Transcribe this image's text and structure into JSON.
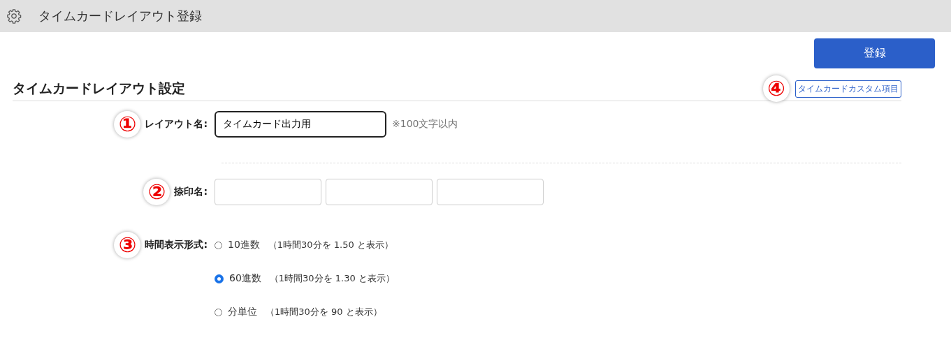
{
  "header": {
    "title": "タイムカードレイアウト登録"
  },
  "register_button": "登録",
  "section": {
    "title": "タイムカードレイアウト設定",
    "marker": "④",
    "custom_link": "タイムカードカスタム項目"
  },
  "layout_name": {
    "marker": "①",
    "label": "レイアウト名:",
    "value": "タイムカード出力用",
    "note": "※100文字以内"
  },
  "seal_names": {
    "marker": "②",
    "label": "捺印名:",
    "fields": [
      {
        "kind": "text"
      },
      {
        "kind": "text"
      },
      {
        "kind": "text"
      }
    ]
  },
  "time_format": {
    "marker": "③",
    "label": "時間表示形式:",
    "options": [
      {
        "label": "10進数",
        "hint": "（1時間30分を 1.50 と表示）",
        "selected": false
      },
      {
        "label": "60進数",
        "hint": "（1時間30分を 1.30 と表示）",
        "selected": true
      },
      {
        "label": "分単位",
        "hint": "（1時間30分を 90 と表示）",
        "selected": false
      }
    ]
  }
}
